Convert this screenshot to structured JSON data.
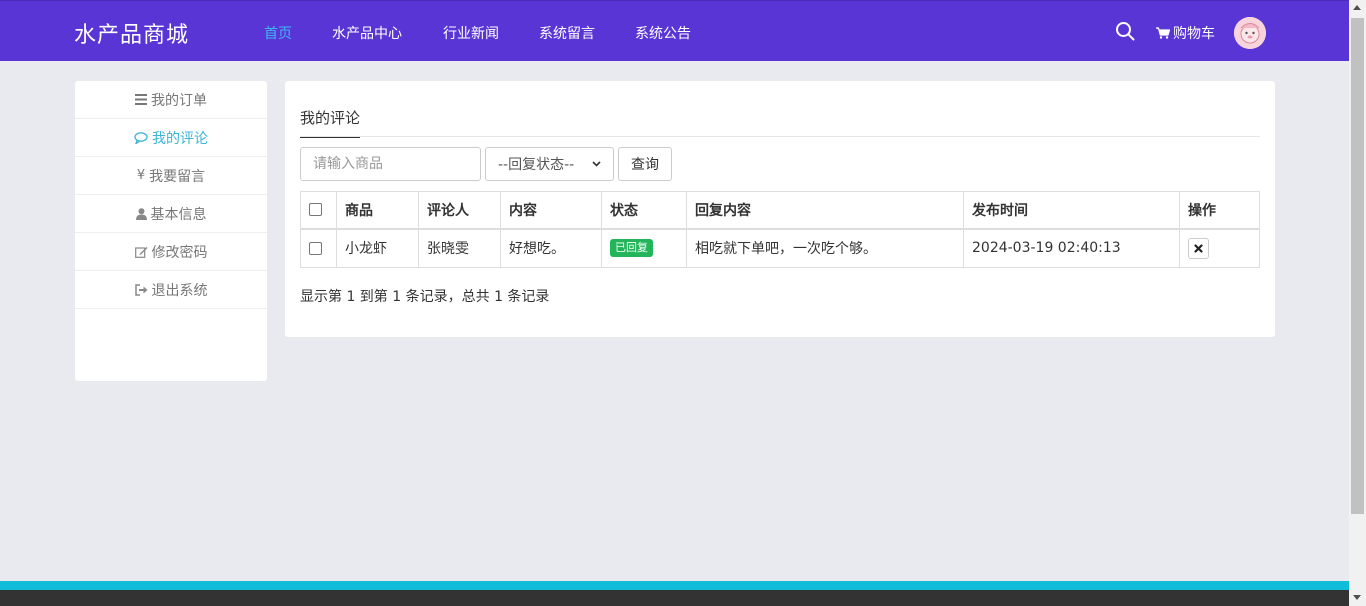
{
  "header": {
    "brand": "水产品商城",
    "nav": [
      {
        "label": "首页",
        "active": true
      },
      {
        "label": "水产品中心"
      },
      {
        "label": "行业新闻"
      },
      {
        "label": "系统留言"
      },
      {
        "label": "系统公告"
      }
    ],
    "cart_label": "购物车",
    "accent_color": "#5a35d6",
    "active_color": "#3fb6f2"
  },
  "sidebar": {
    "items": [
      {
        "label": "我的订单",
        "icon": "list-icon"
      },
      {
        "label": "我的评论",
        "icon": "comment-icon",
        "active": true
      },
      {
        "label": "我要留言",
        "icon": "yen-icon"
      },
      {
        "label": "基本信息",
        "icon": "user-icon"
      },
      {
        "label": "修改密码",
        "icon": "edit-icon"
      },
      {
        "label": "退出系统",
        "icon": "sign-out-icon"
      }
    ]
  },
  "main": {
    "tab_label": "我的评论",
    "search_placeholder": "请输入商品",
    "select_value": "--回复状态--",
    "query_label": "查询",
    "table": {
      "headers": [
        "商品",
        "评论人",
        "内容",
        "状态",
        "回复内容",
        "发布时间",
        "操作"
      ],
      "rows": [
        {
          "product": "小龙虾",
          "reviewer": "张晓雯",
          "content": "好想吃。",
          "status": "已回复",
          "reply": "相吃就下单吧，一次吃个够。",
          "time": "2024-03-19 02:40:13"
        }
      ]
    },
    "page_info": "显示第 1 到第 1 条记录，总共 1 条记录",
    "badge_color": "#22b55a"
  },
  "footer": {
    "accent_color": "#10bcd8"
  }
}
